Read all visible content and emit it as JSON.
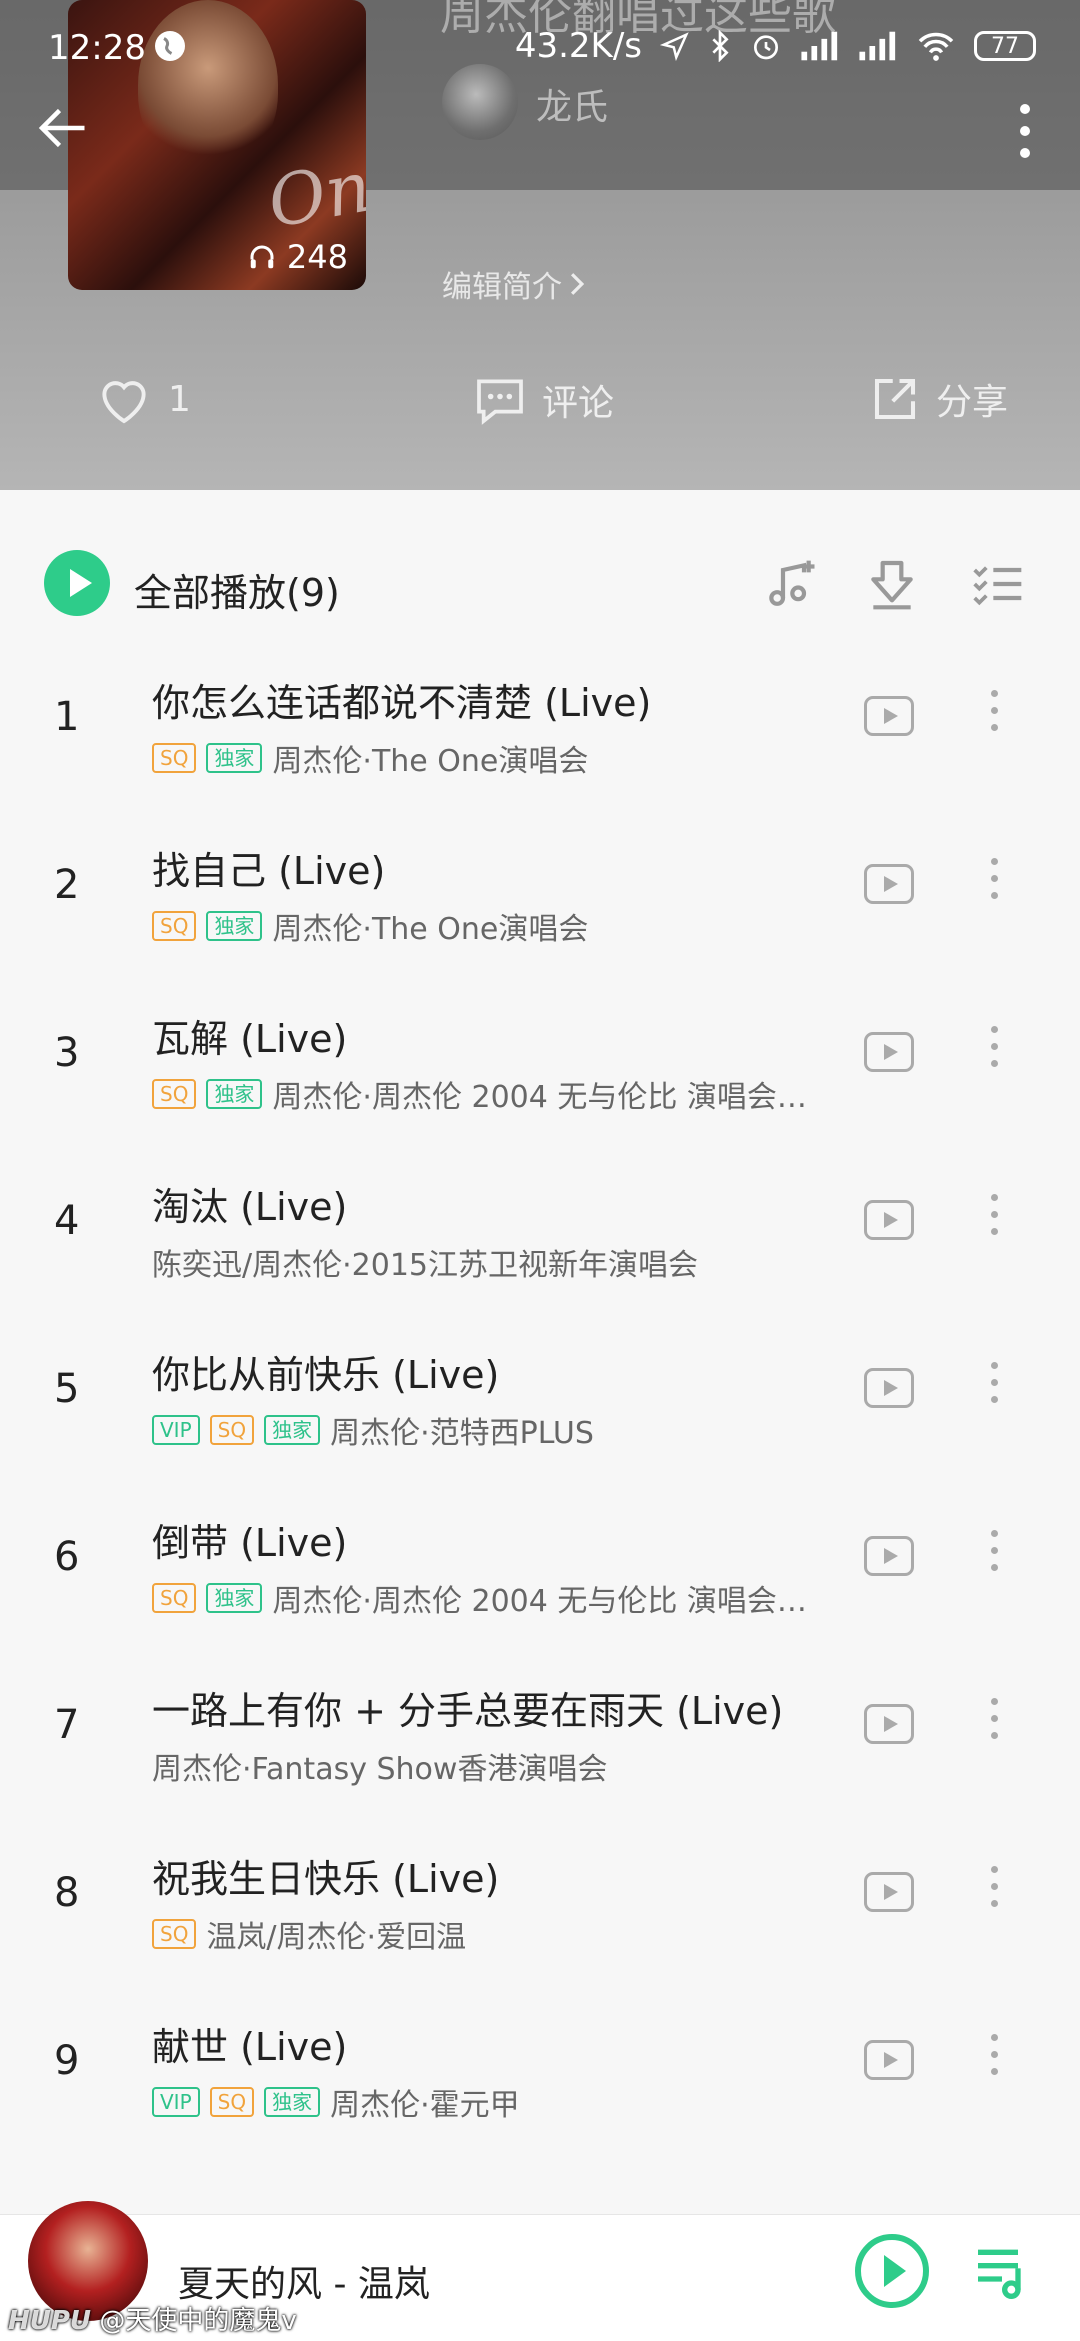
{
  "status_bar": {
    "time": "12:28",
    "network_speed": "43.2K/s",
    "battery": "77"
  },
  "playlist": {
    "title": "周杰伦翻唱过这些歌",
    "author": "龙氏",
    "play_count": "248",
    "edit_intro": "编辑简介",
    "likes": "1",
    "comment_label": "评论",
    "share_label": "分享"
  },
  "toolbar": {
    "play_all_label": "全部播放(9)"
  },
  "songs": [
    {
      "index": "1",
      "name": "你怎么连话都说不清楚 (Live)",
      "badges": [
        "SQ",
        "独家"
      ],
      "meta": "周杰伦·The One演唱会"
    },
    {
      "index": "2",
      "name": "找自己 (Live)",
      "badges": [
        "SQ",
        "独家"
      ],
      "meta": "周杰伦·The One演唱会"
    },
    {
      "index": "3",
      "name": "瓦解 (Live)",
      "badges": [
        "SQ",
        "独家"
      ],
      "meta": "周杰伦·周杰伦 2004 无与伦比 演唱会…"
    },
    {
      "index": "4",
      "name": "淘汰 (Live)",
      "badges": [],
      "meta": "陈奕迅/周杰伦·2015江苏卫视新年演唱会"
    },
    {
      "index": "5",
      "name": "你比从前快乐 (Live)",
      "badges": [
        "VIP",
        "SQ",
        "独家"
      ],
      "meta": "周杰伦·范特西PLUS"
    },
    {
      "index": "6",
      "name": "倒带 (Live)",
      "badges": [
        "SQ",
        "独家"
      ],
      "meta": "周杰伦·周杰伦 2004 无与伦比 演唱会…"
    },
    {
      "index": "7",
      "name": "一路上有你 + 分手总要在雨天 (Live)",
      "badges": [],
      "meta": "周杰伦·Fantasy Show香港演唱会"
    },
    {
      "index": "8",
      "name": "祝我生日快乐 (Live)",
      "badges": [
        "SQ"
      ],
      "meta": "温岚/周杰伦·爱回温"
    },
    {
      "index": "9",
      "name": "献世 (Live)",
      "badges": [
        "VIP",
        "SQ",
        "独家"
      ],
      "meta": "周杰伦·霍元甲"
    }
  ],
  "mini_player": {
    "now_playing": "夏天的风 - 温岚"
  },
  "watermark": {
    "brand": "HUPU",
    "text": "@天使中的魔鬼v"
  },
  "colors": {
    "accent": "#2ecc8a",
    "sq_badge": "#f1a33c",
    "exclusive_badge": "#2ec28a"
  }
}
